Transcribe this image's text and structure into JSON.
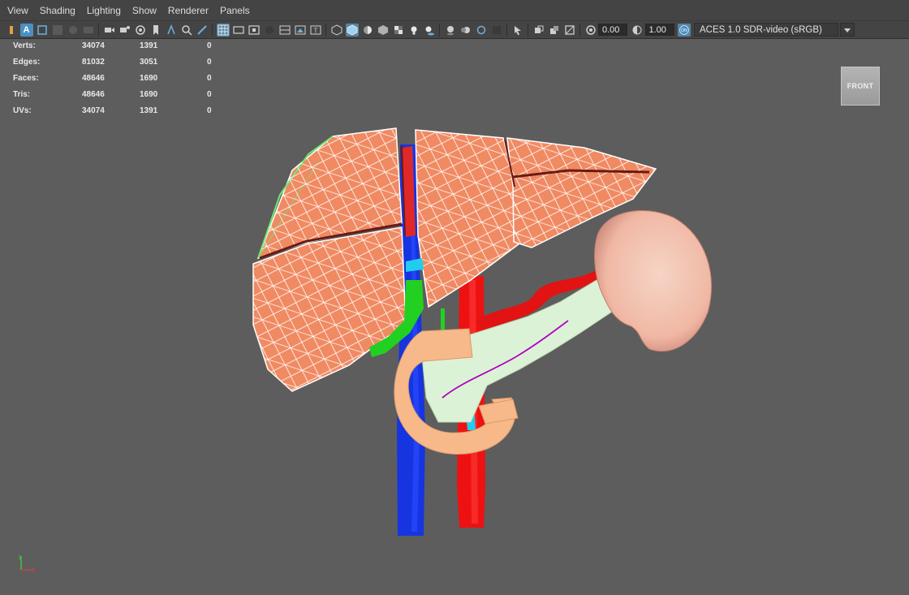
{
  "menu": [
    "View",
    "Shading",
    "Lighting",
    "Show",
    "Renderer",
    "Panels"
  ],
  "toolbar": {
    "select_label": "A",
    "exposure_value": "0.00",
    "gamma_value": "1.00",
    "colorspace_value": "ACES 1.0 SDR-video (sRGB)"
  },
  "hud": {
    "rows": [
      {
        "label": "Verts:",
        "c1": "34074",
        "c2": "1391",
        "c3": "0"
      },
      {
        "label": "Edges:",
        "c1": "81032",
        "c2": "3051",
        "c3": "0"
      },
      {
        "label": "Faces:",
        "c1": "48646",
        "c2": "1690",
        "c3": "0"
      },
      {
        "label": "Tris:",
        "c1": "48646",
        "c2": "1690",
        "c3": "0"
      },
      {
        "label": "UVs:",
        "c1": "34074",
        "c2": "1391",
        "c3": "0"
      }
    ]
  },
  "viewcube": {
    "label": "FRONT"
  },
  "axis": {
    "y": "y",
    "x": "x"
  },
  "colors": {
    "viewport_bg": "#5d5d5d",
    "liver": "#f08a62",
    "wireframe": "#ffffff",
    "vena_cava": "#1634e0",
    "aorta": "#ee1111",
    "bile_duct": "#22d022",
    "pancreas": "#dcf2d6",
    "duodenum": "#f7b98a",
    "spleen": "#f4c4b4",
    "selection_green": "#6fe86f",
    "active_blue": "#4b90c2"
  },
  "icons": [
    "select-mode-icon",
    "marquee-icon",
    "grid-snap-icon",
    "camera-icon",
    "camera-attr-icon",
    "bookmark-icon",
    "pan-icon",
    "grease-pencil-icon",
    "grid-icon",
    "film-gate-icon",
    "resolution-gate-icon",
    "wireframe-icon",
    "smooth-shade-icon",
    "textured-icon",
    "lights-icon",
    "shadows-icon",
    "isolate-icon",
    "xray-icon",
    "exposure-icon",
    "gamma-icon",
    "colorspace-toggle-icon"
  ]
}
